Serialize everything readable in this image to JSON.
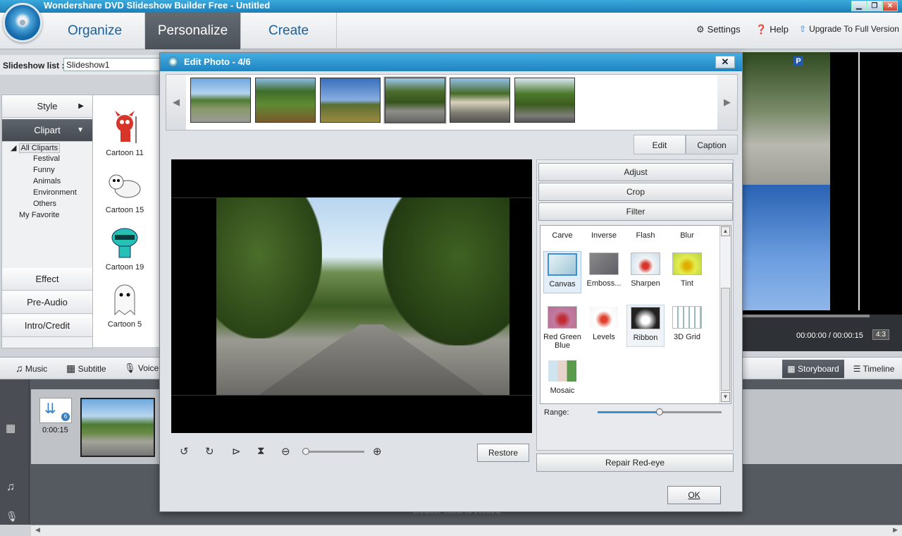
{
  "app": {
    "title": "Wondershare DVD Slideshow Builder Free - Untitled"
  },
  "menu": {
    "tabs": [
      "Organize",
      "Personalize",
      "Create"
    ],
    "settings": "Settings",
    "help": "Help",
    "upgrade": "Upgrade To Full Version"
  },
  "slideshow": {
    "label": "Slideshow list :",
    "value": "Slideshow1"
  },
  "left_tabs": {
    "style": "Style",
    "clipart": "Clipart",
    "effect": "Effect",
    "preaudio": "Pre-Audio",
    "intro": "Intro/Credit"
  },
  "tree": {
    "root": "All Cliparts",
    "items": [
      "Festival",
      "Funny",
      "Animals",
      "Environment",
      "Others"
    ],
    "favorite": "My Favorite"
  },
  "cliparts": [
    "Cartoon 11",
    "Cartoon 15",
    "Cartoon 19",
    "Cartoon 5"
  ],
  "bottom": {
    "music": "Music",
    "subtitle": "Subtitle",
    "voice": "Voice C",
    "storyboard": "Storyboard",
    "timeline": "Timeline",
    "duration": "0:00:15",
    "badge": "6",
    "record_hint": "Double-click to record"
  },
  "preview": {
    "time": "00:00:00 / 00:00:15",
    "ratio": "4:3"
  },
  "dialog": {
    "title": "Edit Photo - 4/6",
    "tab_edit": "Edit",
    "tab_caption": "Caption",
    "adjust": "Adjust",
    "crop": "Crop",
    "filter": "Filter",
    "filters": [
      "Carve",
      "Inverse",
      "Flash",
      "Blur",
      "Canvas",
      "Emboss...",
      "Sharpen",
      "Tint",
      "Red Green Blue",
      "Levels",
      "Ribbon",
      "3D Grid",
      "Mosaic"
    ],
    "range_label": "Range:",
    "range_value": 0.5,
    "restore": "Restore",
    "repair": "Repair Red-eye",
    "ok": "OK",
    "selected_thumb": 4,
    "selected_filter": "Canvas"
  },
  "colors": {
    "accent": "#1f83c0",
    "active_tab": "#4c525a",
    "menu_text": "#1b5f99"
  }
}
